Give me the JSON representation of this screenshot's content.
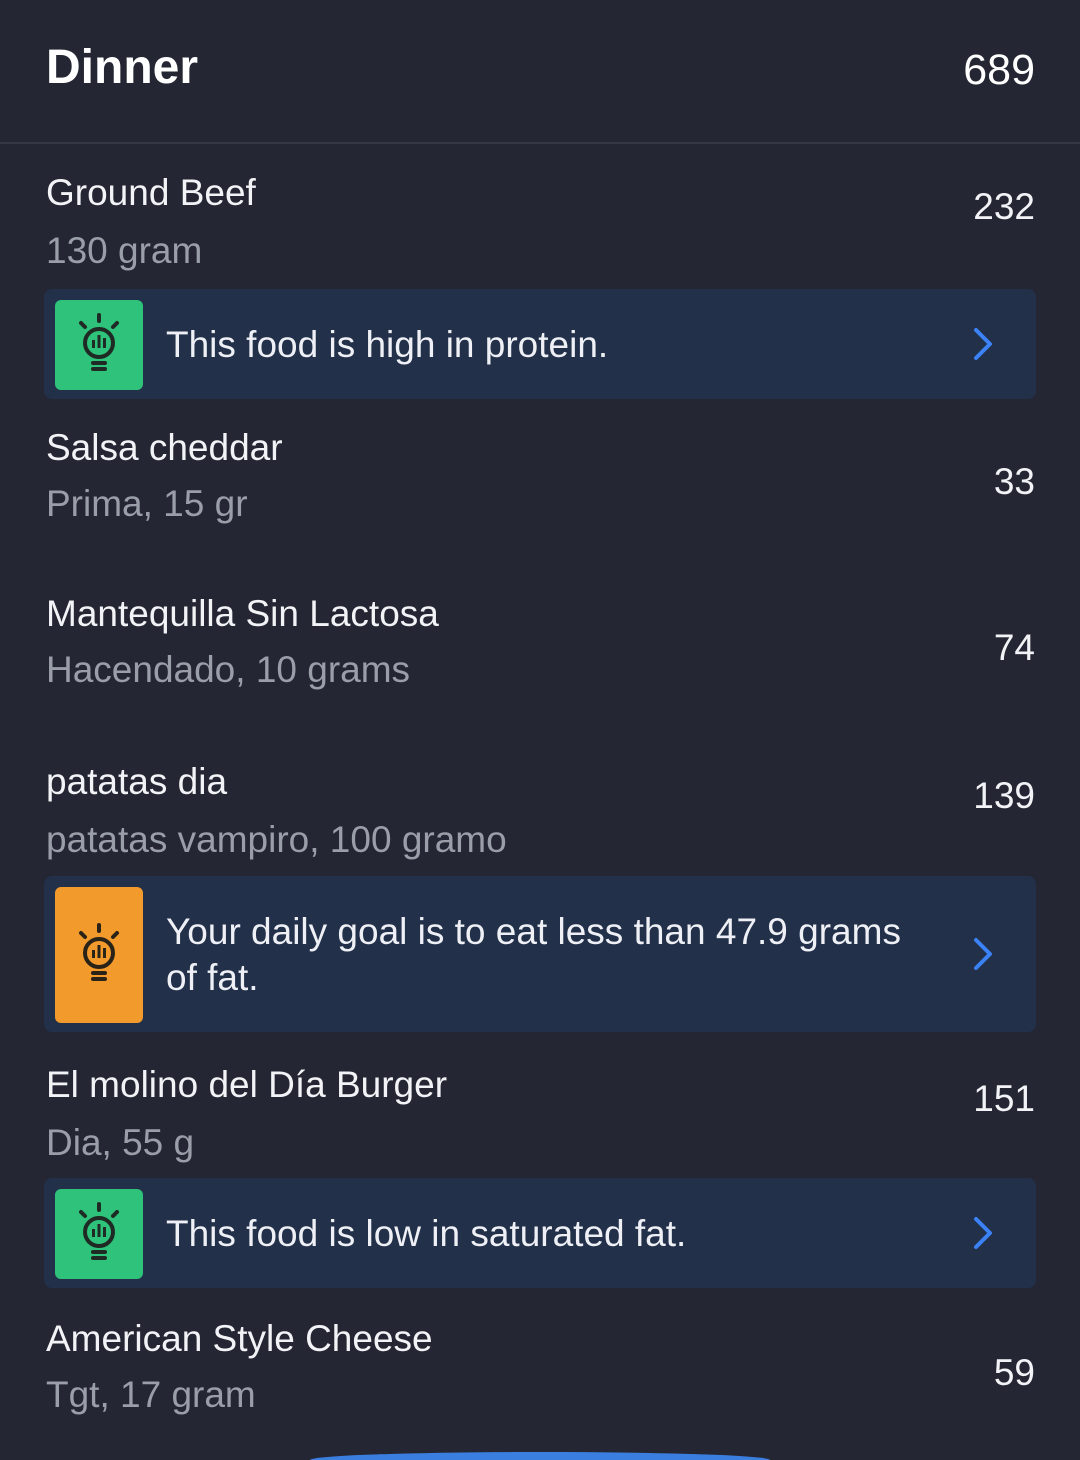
{
  "meal": {
    "title": "Dinner",
    "total": "689"
  },
  "foods": [
    {
      "name": "Ground Beef",
      "detail": "130 gram",
      "calories": "232"
    },
    {
      "name": "Salsa cheddar",
      "detail": "Prima, 15 gr",
      "calories": "33"
    },
    {
      "name": "Mantequilla Sin Lactosa",
      "detail": "Hacendado, 10 grams",
      "calories": "74"
    },
    {
      "name": "patatas dia",
      "detail": "patatas vampiro, 100 gramo",
      "calories": "139"
    },
    {
      "name": "El molino del Día Burger",
      "detail": "Dia, 55 g",
      "calories": "151"
    },
    {
      "name": "American Style Cheese",
      "detail": "Tgt, 17 gram",
      "calories": "59"
    }
  ],
  "tips": [
    {
      "text": "This food is high in protein.",
      "icon": "lightbulb-icon",
      "color": "#2ec27a"
    },
    {
      "text": "Your daily goal is to eat less than 47.9 grams of fat.",
      "icon": "lightbulb-icon",
      "color": "#f39a2c"
    },
    {
      "text": "This food is low in saturated fat.",
      "icon": "lightbulb-icon",
      "color": "#2ec27a"
    }
  ],
  "colors": {
    "background": "#242733",
    "tip_background": "#22304a",
    "chevron": "#3b82f6"
  }
}
